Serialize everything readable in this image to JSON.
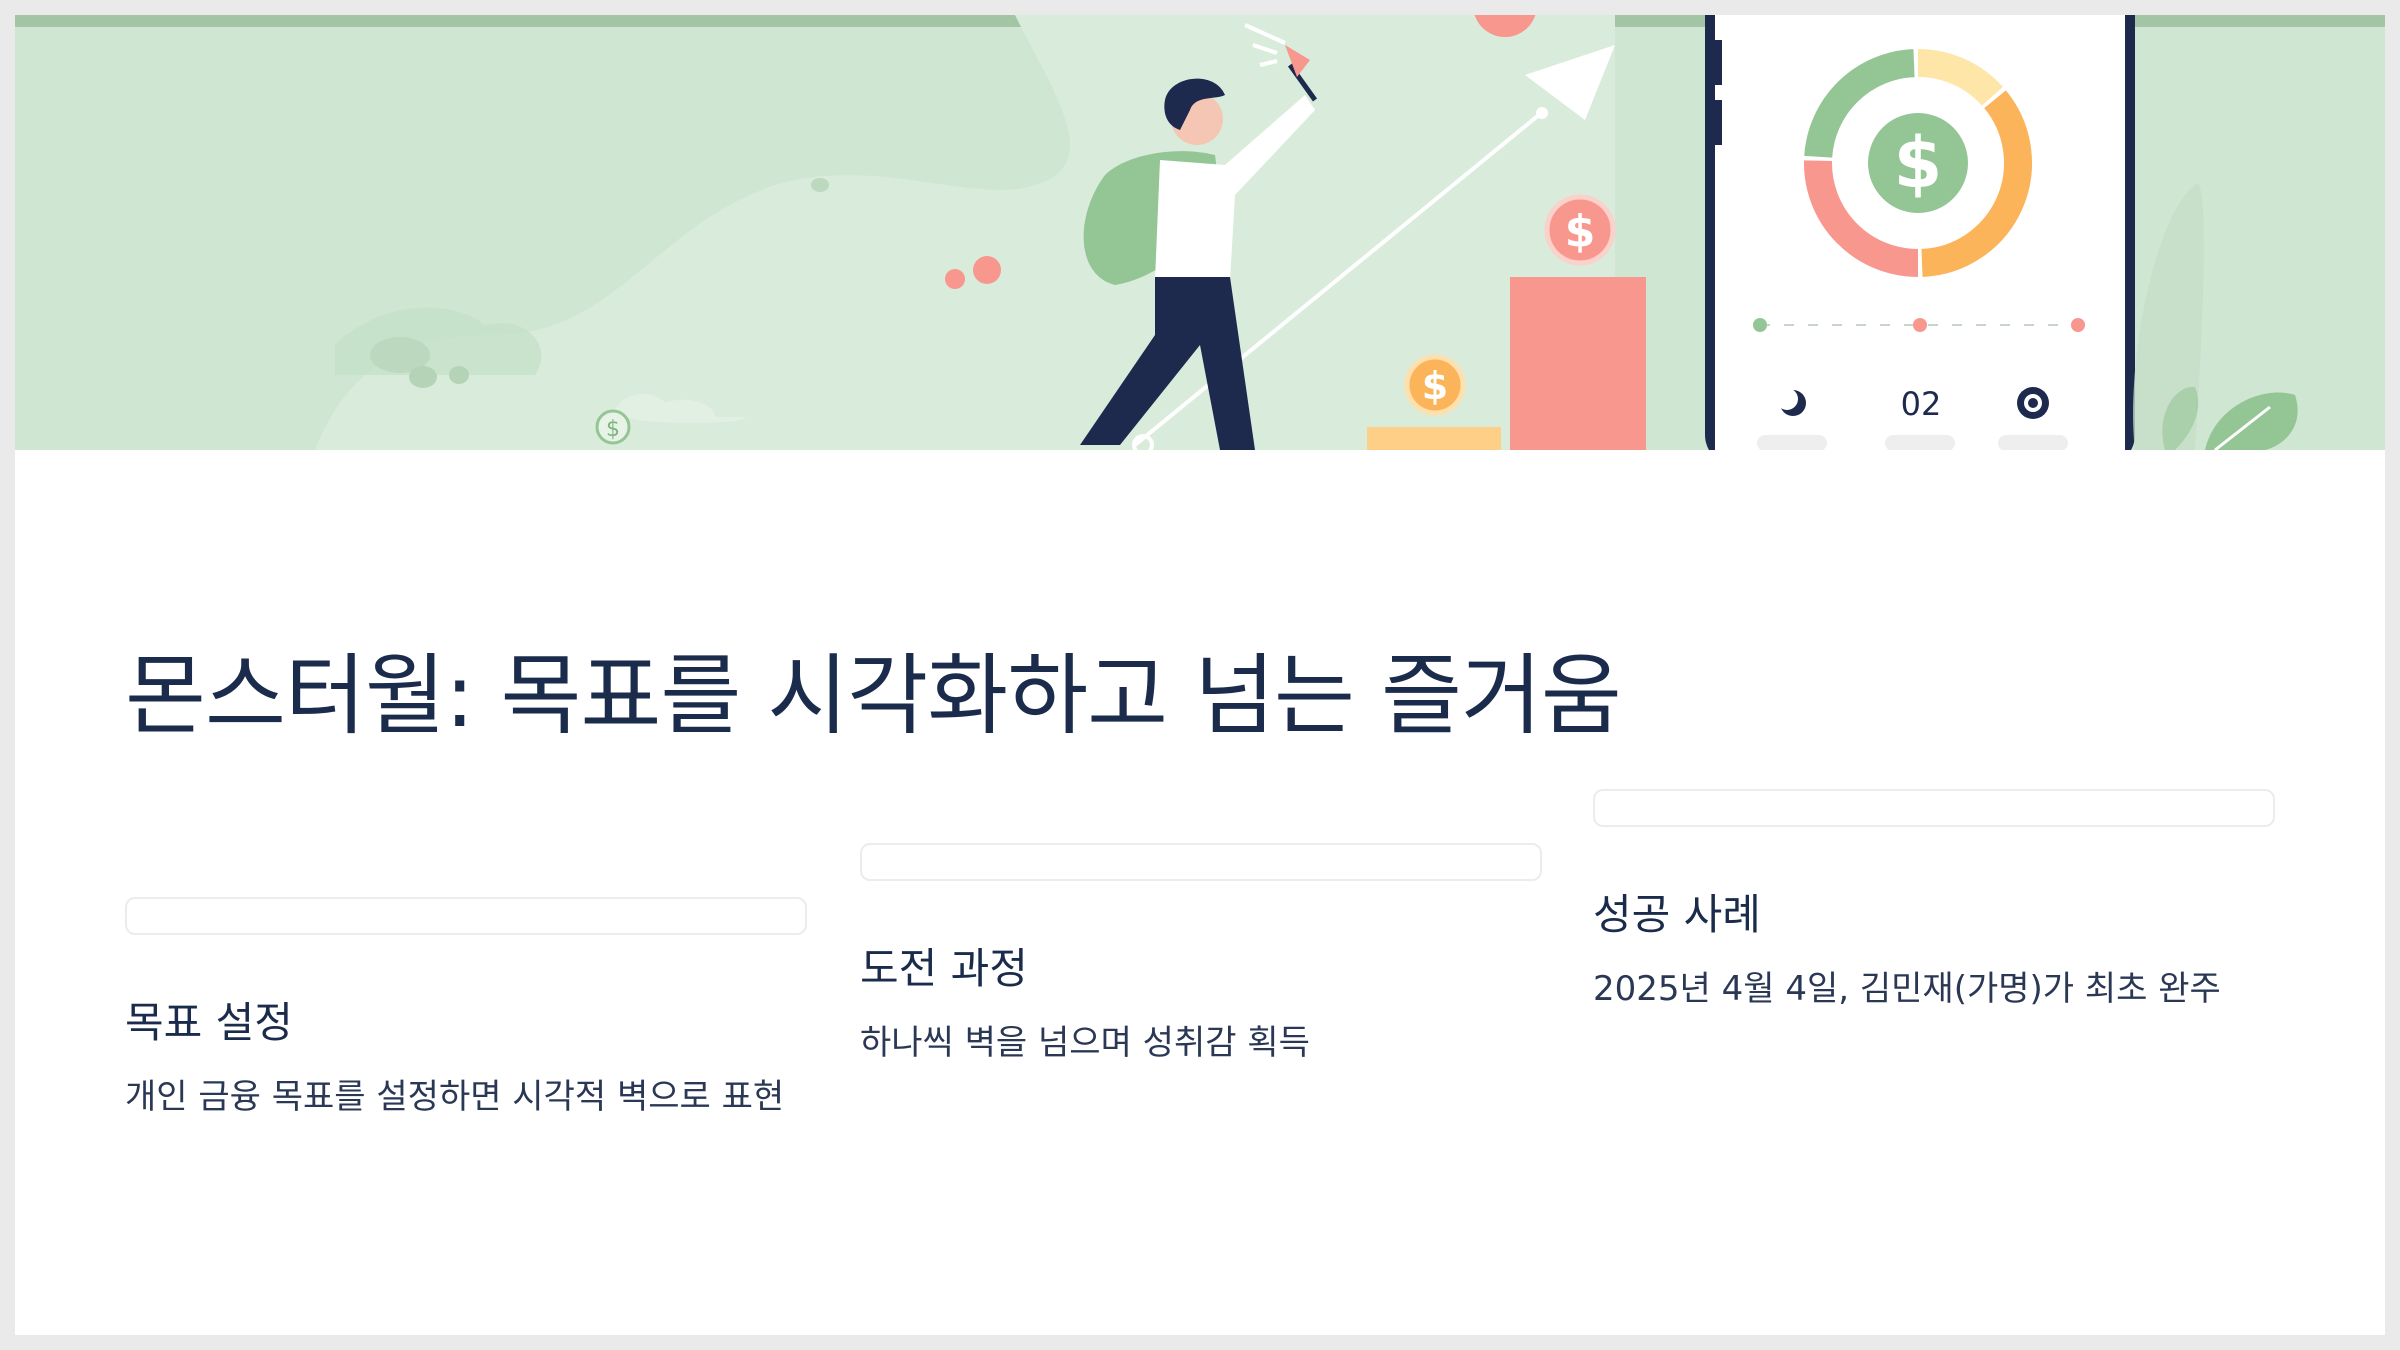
{
  "banner": {
    "phone_counter": "02",
    "colors": {
      "background": "#cfe6d2",
      "green": "#94c595",
      "coral": "#f7978e",
      "orange": "#fbb45a",
      "yellow": "#fde6a8",
      "navy": "#1d2a4d"
    },
    "donut_segments": [
      {
        "color": "#fde6a8",
        "fraction": 0.14
      },
      {
        "color": "#fbb45a",
        "fraction": 0.36
      },
      {
        "color": "#f7978e",
        "fraction": 0.26
      },
      {
        "color": "#94c595",
        "fraction": 0.24
      }
    ],
    "icons": [
      "dollar-icon",
      "moon-icon",
      "target-icon",
      "leaf-icon",
      "flag-icon",
      "arrow-icon"
    ]
  },
  "title": "몬스터월: 목표를 시각화하고 넘는 즐거움",
  "columns": [
    {
      "heading": "목표 설정",
      "description": "개인 금융 목표를 설정하면 시각적 벽으로 표현"
    },
    {
      "heading": "도전 과정",
      "description": "하나씩 벽을 넘으며 성취감 획득"
    },
    {
      "heading": "성공 사례",
      "description": "2025년 4월 4일, 김민재(가명)가 최초 완주"
    }
  ]
}
